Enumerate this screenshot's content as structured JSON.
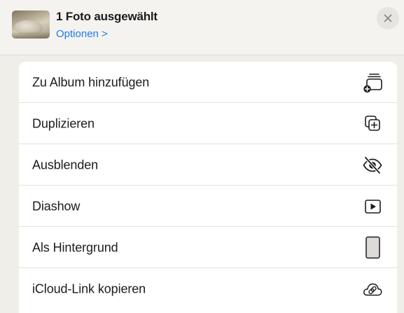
{
  "header": {
    "title": "1 Foto ausgewählt",
    "options_link": "Optionen >",
    "close_icon": "xmark-icon",
    "thumbnail": "photo-thumbnail"
  },
  "menu": {
    "items": [
      {
        "label": "Zu Album hinzufügen",
        "icon": "add-to-album-icon"
      },
      {
        "label": "Duplizieren",
        "icon": "duplicate-icon"
      },
      {
        "label": "Ausblenden",
        "icon": "eye-slash-icon"
      },
      {
        "label": "Diashow",
        "icon": "play-rectangle-icon"
      },
      {
        "label": "Als Hintergrund",
        "icon": "wallpaper-rectangle-icon"
      },
      {
        "label": "iCloud-Link kopieren",
        "icon": "link-cloud-icon"
      }
    ]
  },
  "colors": {
    "accent": "#1e7bf2",
    "text": "#1c1c1e",
    "background": "#efeee9",
    "card": "#ffffff",
    "separator": "#e2e1dc"
  }
}
